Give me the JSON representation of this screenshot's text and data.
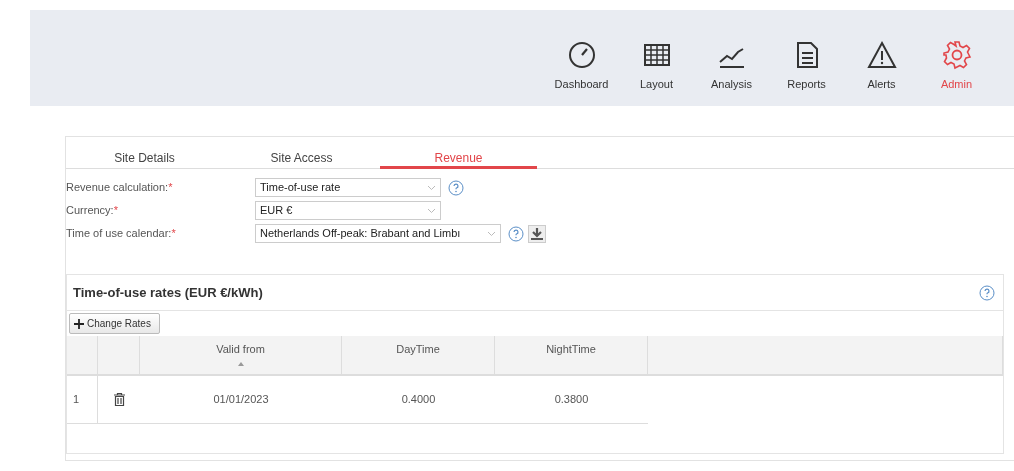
{
  "nav": [
    {
      "label": "Dashboard",
      "selected": false
    },
    {
      "label": "Layout",
      "selected": false
    },
    {
      "label": "Analysis",
      "selected": false
    },
    {
      "label": "Reports",
      "selected": false
    },
    {
      "label": "Alerts",
      "selected": false
    },
    {
      "label": "Admin",
      "selected": true
    }
  ],
  "tabs": [
    {
      "label": "Site Details",
      "selected": false
    },
    {
      "label": "Site Access",
      "selected": false
    },
    {
      "label": "Revenue",
      "selected": true
    }
  ],
  "form": [
    {
      "label": "Revenue calculation:",
      "required": "*",
      "value": "Time-of-use rate",
      "help": true,
      "download": false,
      "wide": false
    },
    {
      "label": "Currency:",
      "required": "*",
      "value": "EUR €",
      "help": false,
      "download": false,
      "wide": false
    },
    {
      "label": "Time of use calendar:",
      "required": "*",
      "value": "Netherlands Off-peak: Brabant and Limbı",
      "help": true,
      "download": true,
      "wide": true
    }
  ],
  "rates": {
    "title": "Time-of-use rates (EUR €/kWh)",
    "button": "Change Rates",
    "columns": [
      "Valid from",
      "DayTime",
      "NightTime"
    ],
    "rows": [
      {
        "number": "1",
        "cells": [
          "01/01/2023",
          "0.4000",
          "0.3800"
        ]
      }
    ]
  }
}
